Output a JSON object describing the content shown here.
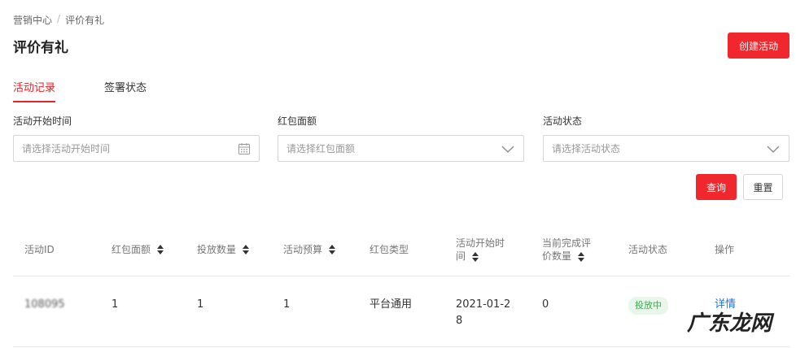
{
  "breadcrumb": {
    "root": "营销中心",
    "separator": "/",
    "current": "评价有礼"
  },
  "page": {
    "title": "评价有礼",
    "create_label": "创建活动"
  },
  "tabs": [
    {
      "label": "活动记录",
      "active": true
    },
    {
      "label": "签署状态",
      "active": false
    }
  ],
  "filters": {
    "start_time": {
      "label": "活动开始时间",
      "placeholder": "请选择活动开始时间"
    },
    "amount": {
      "label": "红包面额",
      "placeholder": "请选择红包面额"
    },
    "status": {
      "label": "活动状态",
      "placeholder": "请选择活动状态"
    }
  },
  "actions": {
    "query_label": "查询",
    "reset_label": "重置"
  },
  "table": {
    "columns": [
      {
        "label": "活动ID",
        "sortable": false
      },
      {
        "label": "红包面额",
        "sortable": true
      },
      {
        "label": "投放数量",
        "sortable": true
      },
      {
        "label": "活动预算",
        "sortable": true
      },
      {
        "label": "红包类型",
        "sortable": false
      },
      {
        "label": "活动开始时间",
        "sortable": true
      },
      {
        "label": "当前完成评价数量",
        "sortable": true
      },
      {
        "label": "活动状态",
        "sortable": false
      },
      {
        "label": "操作",
        "sortable": false
      }
    ],
    "rows": [
      {
        "id": "108095",
        "amount": "1",
        "quantity": "1",
        "budget": "1",
        "type": "平台通用",
        "start_time": "2021-01-28",
        "completed": "0",
        "status": "投放中",
        "action": "详情"
      }
    ]
  },
  "watermark": "广东龙网",
  "colors": {
    "primary": "#f0282d",
    "link": "#1a73e8",
    "status_bg": "#e8f7ea",
    "status_text": "#33b04a"
  }
}
